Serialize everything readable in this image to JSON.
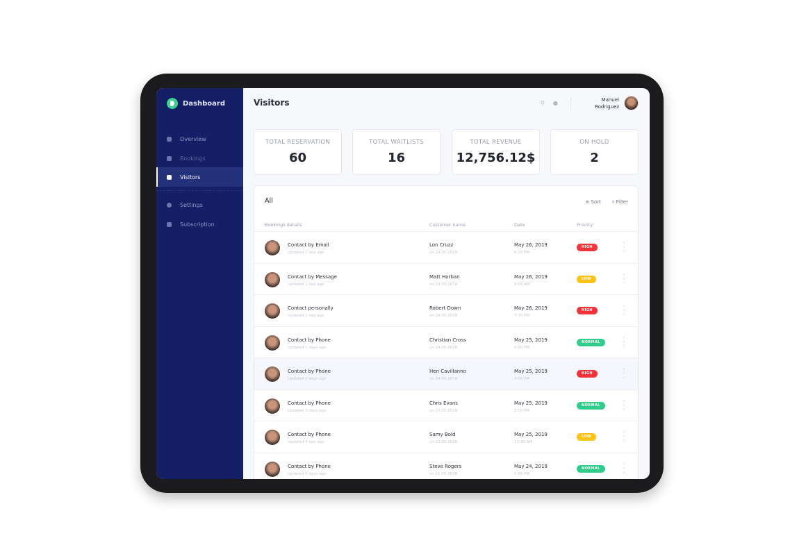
{
  "app": {
    "title": "Dashboard"
  },
  "sidebar": {
    "items": [
      {
        "label": "Overview",
        "icon": "pie-chart-icon"
      },
      {
        "label": "Bookings",
        "icon": "ticket-icon"
      },
      {
        "label": "Visitors",
        "icon": "book-icon",
        "active": true
      },
      {
        "label": "Settings",
        "icon": "gear-icon"
      },
      {
        "label": "Subscription",
        "icon": "badge-icon"
      }
    ]
  },
  "header": {
    "title": "Visitors",
    "user_first": "Manuel",
    "user_last": "Rodriguez"
  },
  "stats": [
    {
      "label": "TOTAL RESERVATION",
      "value": "60"
    },
    {
      "label": "TOTAL WAITLISTS",
      "value": "16"
    },
    {
      "label": "TOTAL REVENUE",
      "value": "12,756.12$"
    },
    {
      "label": "ON HOLD",
      "value": "2"
    }
  ],
  "table": {
    "filter_label": "All",
    "sort_label": "Sort",
    "filter_button": "Filter",
    "columns": [
      "Bookings details",
      "Customer name",
      "Date",
      "Priority"
    ],
    "priority_colors": {
      "HIGH": "#f2333a",
      "LOW": "#fcc419",
      "NORMAL": "#2fcc8b"
    },
    "rows": [
      {
        "detail": "Contact by Email",
        "updated": "Updated 1 day ago",
        "customer": "Lon Cruzz",
        "on": "on 24.05.2019",
        "date": "May 26, 2019",
        "time": "6:30 PM",
        "priority": "HIGH"
      },
      {
        "detail": "Contact by Message",
        "updated": "Updated 1 day ago",
        "customer": "Matt Horban",
        "on": "on 24.05.2019",
        "date": "May 26, 2019",
        "time": "8:00 AM",
        "priority": "LOW"
      },
      {
        "detail": "Contact personally",
        "updated": "Updated 1 day ago",
        "customer": "Robert Down",
        "on": "on 24.05.2019",
        "date": "May 26, 2019",
        "time": "7:30 PM",
        "priority": "HIGH"
      },
      {
        "detail": "Contact by Phone",
        "updated": "Updated 2 days ago",
        "customer": "Christian Cross",
        "on": "on 24.05.2019",
        "date": "May 25, 2019",
        "time": "5:00 PM",
        "priority": "NORMAL"
      },
      {
        "detail": "Contact by Phone",
        "updated": "Updated 2 days ago",
        "customer": "Hen Cavillanno",
        "on": "on 24.05.2019",
        "date": "May 25, 2019",
        "time": "4:00 PM",
        "priority": "HIGH"
      },
      {
        "detail": "Contact by Phone",
        "updated": "Updated 3 days ago",
        "customer": "Chris Evans",
        "on": "on 23.05.2019",
        "date": "May 25, 2019",
        "time": "2:00 PM",
        "priority": "NORMAL"
      },
      {
        "detail": "Contact by Phone",
        "updated": "Updated 4 day ago",
        "customer": "Samy Bold",
        "on": "on 22.05.2019",
        "date": "May 25, 2019",
        "time": "11:30 AM",
        "priority": "LOW"
      },
      {
        "detail": "Contact by Phone",
        "updated": "Updated 6 days ago",
        "customer": "Steve Rogers",
        "on": "on 21.05.2019",
        "date": "May 24, 2019",
        "time": "1:00 PM",
        "priority": "NORMAL"
      }
    ]
  }
}
